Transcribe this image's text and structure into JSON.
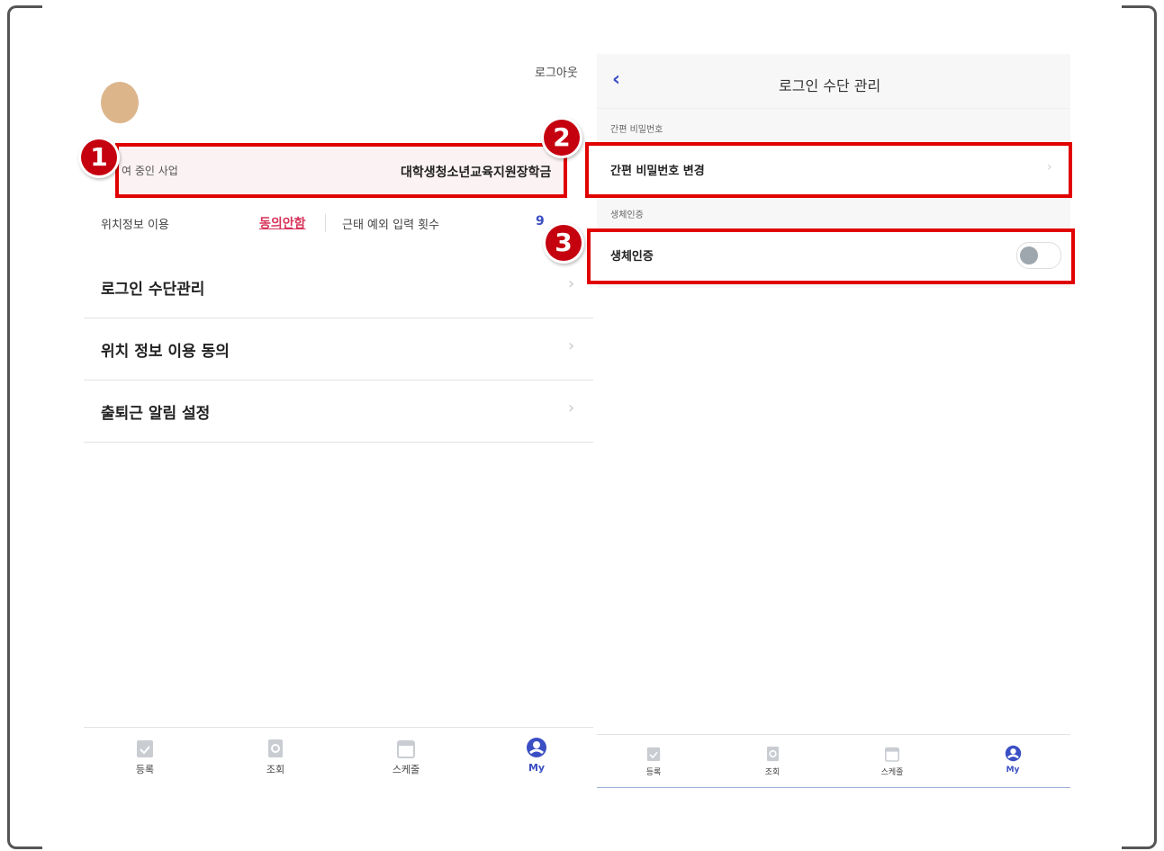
{
  "left": {
    "logout": "로그아웃",
    "biz_label": "여 중인 사업",
    "biz_value": "대학생청소년교육지원장학금",
    "loc_label": "위치정보 이용",
    "loc_value": "동의안함",
    "exc_label": "근태 예외 입력 횟수",
    "exc_value": "9",
    "menu": [
      "로그인 수단관리",
      "위치 정보 이용 동의",
      "출퇴근 알림 설정"
    ],
    "tabs": [
      "등록",
      "조회",
      "스케줄",
      "My"
    ]
  },
  "right": {
    "title": "로그인 수단 관리",
    "section_pin": "간편 비밀번호",
    "pin_change": "간편 비밀번호 변경",
    "section_bio": "생체인증",
    "bio_label": "생체인증",
    "bio_enabled": false,
    "tabs": [
      "등록",
      "조회",
      "스케줄",
      "My"
    ]
  },
  "badges": [
    "1",
    "2",
    "3"
  ],
  "colors": {
    "accent": "#3b4fc4",
    "highlight": "#e00000",
    "link_red": "#d8335a",
    "badge": "#c5000f"
  }
}
